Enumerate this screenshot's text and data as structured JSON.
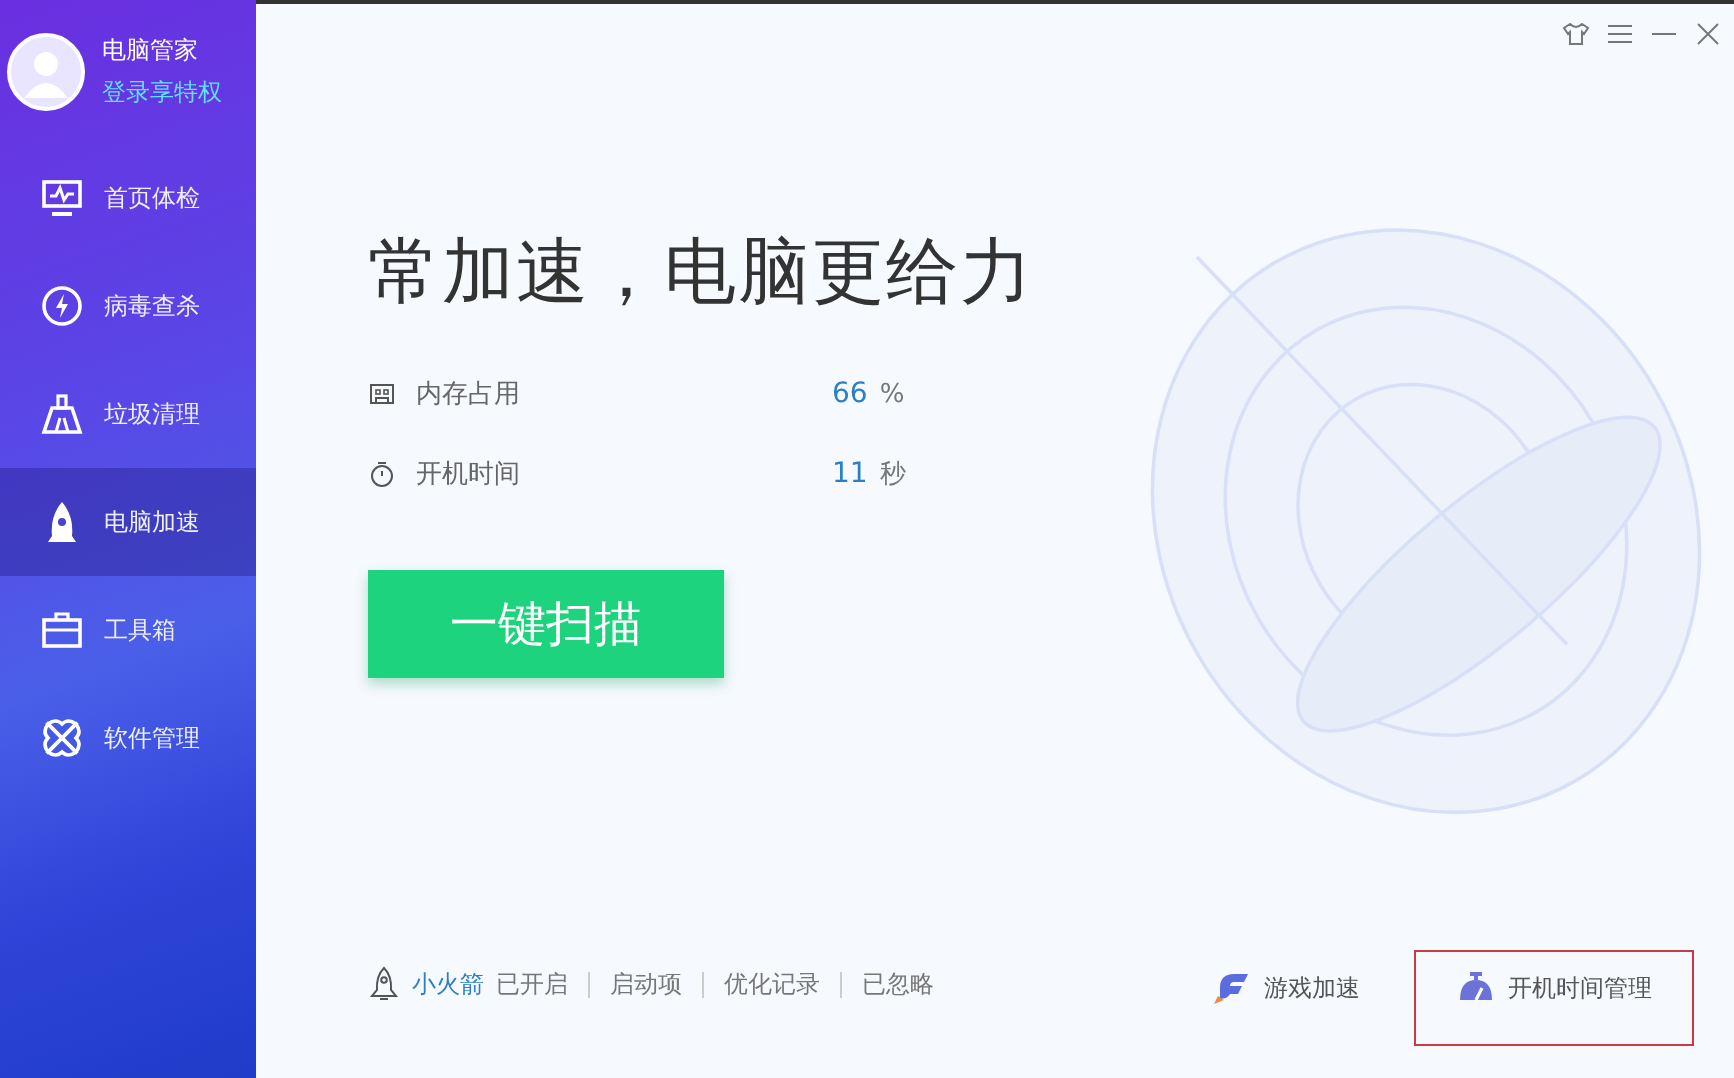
{
  "sidebar": {
    "profile": {
      "name": "电脑管家",
      "login_link": "登录享特权"
    },
    "items": [
      {
        "label": "首页体检",
        "selected": false
      },
      {
        "label": "病毒查杀",
        "selected": false
      },
      {
        "label": "垃圾清理",
        "selected": false
      },
      {
        "label": "电脑加速",
        "selected": true
      },
      {
        "label": "工具箱",
        "selected": false
      },
      {
        "label": "软件管理",
        "selected": false
      }
    ]
  },
  "main": {
    "headline": "常加速，电脑更给力",
    "metrics": [
      {
        "label": "内存占用",
        "value": "66",
        "unit": "%"
      },
      {
        "label": "开机时间",
        "value": "11",
        "unit": "秒"
      }
    ],
    "scan_button": "一键扫描",
    "footer": {
      "rocket_name": "小火箭",
      "rocket_status": "已开启",
      "links": [
        "启动项",
        "优化记录",
        "已忽略"
      ]
    },
    "tools": [
      {
        "label": "游戏加速",
        "highlighted": false
      },
      {
        "label": "开机时间管理",
        "highlighted": true
      }
    ]
  }
}
